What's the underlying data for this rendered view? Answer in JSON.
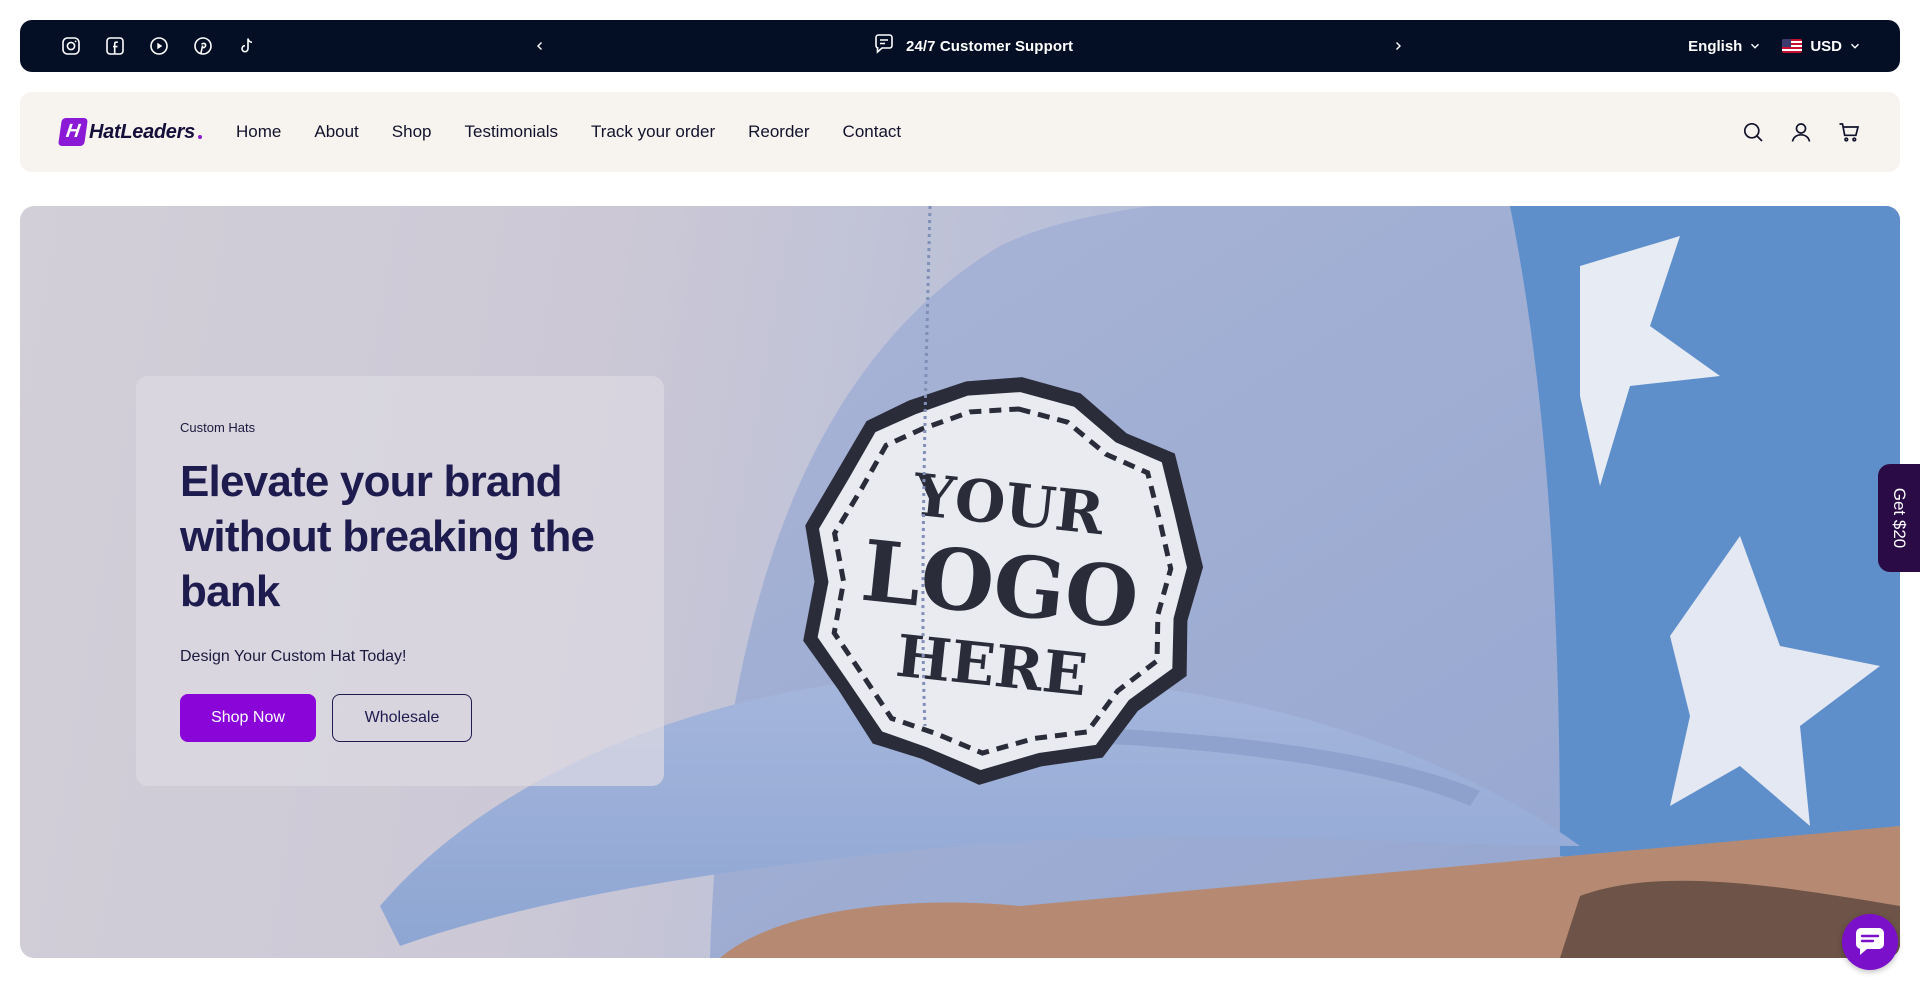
{
  "announcement": {
    "socials": [
      {
        "icon": "instagram-icon"
      },
      {
        "icon": "facebook-icon"
      },
      {
        "icon": "youtube-icon"
      },
      {
        "icon": "pinterest-icon"
      },
      {
        "icon": "tiktok-icon"
      }
    ],
    "message": "24/7 Customer Support",
    "language": "English",
    "currency": "USD"
  },
  "header": {
    "logo_text": "HatLeaders",
    "logo_mark": "H",
    "nav": [
      "Home",
      "About",
      "Shop",
      "Testimonials",
      "Track your order",
      "Reorder",
      "Contact"
    ]
  },
  "hero": {
    "eyebrow": "Custom Hats",
    "headline": "Elevate your brand without breaking the bank",
    "subheadline": "Design Your Custom Hat Today!",
    "primary_cta": "Shop Now",
    "secondary_cta": "Wholesale",
    "patch_lines": [
      "YOUR",
      "LOGO",
      "HERE"
    ]
  },
  "side_tab": {
    "label": "Get $20"
  },
  "colors": {
    "announcement_bg": "#040f25",
    "header_bg": "#f7f4ef",
    "brand_purple": "#8a06d8",
    "headline_navy": "#1e1b4f",
    "side_tab_bg": "#2a0b45"
  }
}
